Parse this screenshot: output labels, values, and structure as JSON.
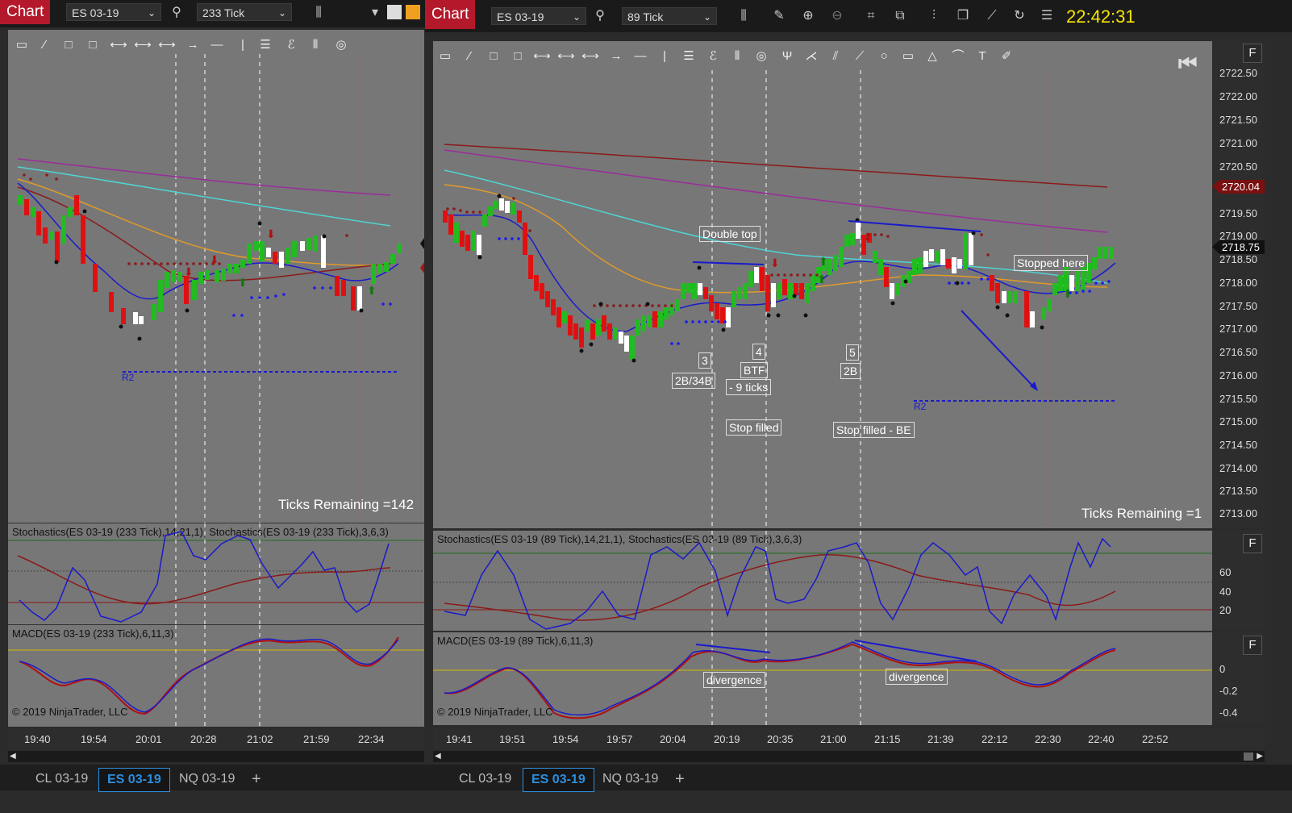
{
  "left": {
    "toolbar": {
      "chart_label": "Chart",
      "instrument": "ES 03-19",
      "interval": "233 Tick"
    },
    "drawing_tools": [
      "ruler-icon",
      "risk-reward-icon",
      "rectangle-icon",
      "rectangle-icon",
      "line-icon",
      "line-icon",
      "line-icon",
      "arrow-line-icon",
      "horizontal-line-icon",
      "vertical-line-icon",
      "lines-icon",
      "fib-icon",
      "time-cycles-icon",
      "circle-target-icon"
    ],
    "ticks_remaining": "Ticks Remaining =142",
    "r2_label": "R2",
    "stoch_title": "Stochastics(ES 03-19 (233 Tick),14,21,1), Stochastics(ES 03-19 (233 Tick),3,6,3)",
    "macd_title": "MACD(ES 03-19 (233 Tick),6,11,3)",
    "copyright": "© 2019 NinjaTrader, LLC",
    "time_ticks": [
      "19:40",
      "19:54",
      "20:01",
      "20:28",
      "21:02",
      "21:59",
      "22:34"
    ],
    "tabs": [
      "CL 03-19",
      "ES 03-19",
      "NQ 03-19"
    ],
    "add_tab": "+",
    "active_tab": "ES 03-19"
  },
  "right": {
    "toolbar": {
      "chart_label": "Chart",
      "instrument": "ES 03-19",
      "interval": "89 Tick",
      "clock": "22:42:31"
    },
    "drawing_tools": [
      "ruler-icon",
      "risk-reward-icon",
      "rectangle-icon",
      "rectangle-icon",
      "line-icon",
      "line-icon",
      "line-icon",
      "arrow-line-icon",
      "horizontal-line-icon",
      "vertical-line-icon",
      "lines-icon",
      "fib-icon",
      "time-cycles-icon",
      "circle-target-icon",
      "pitchfork-icon",
      "gann-fan-icon",
      "regression-icon",
      "ray-icon",
      "ellipse-icon",
      "rectangle-icon",
      "triangle-icon",
      "arc-icon",
      "text-icon",
      "marker-icon"
    ],
    "price_ticks": [
      "2722.50",
      "2722.00",
      "2721.50",
      "2721.00",
      "2720.50",
      "2720.00",
      "2719.50",
      "2719.00",
      "2718.50",
      "2718.00",
      "2717.50",
      "2717.00",
      "2716.50",
      "2716.00",
      "2715.50",
      "2715.00",
      "2714.50",
      "2714.00",
      "2713.50",
      "2713.00"
    ],
    "price_flag_red": "2720.04",
    "price_flag_current": "2718.75",
    "annotations": {
      "double_top": "Double top",
      "n3": "3",
      "n3_label": "2B/34B",
      "n4": "4",
      "n4_label": "BTF",
      "n4_ticks": "- 9 ticks",
      "stop_filled": "Stop filled",
      "n5": "5",
      "n5_label": "2B",
      "stop_filled_be": "Stop filled - BE",
      "stopped_here": "Stopped here",
      "divergence1": "divergence",
      "divergence2": "divergence"
    },
    "r2_label": "R2",
    "ticks_remaining": "Ticks Remaining =1",
    "stoch_title": "Stochastics(ES 03-19 (89 Tick),14,21,1), Stochastics(ES 03-19 (89 Tick),3,6,3)",
    "stoch_axis": [
      "60",
      "40",
      "20"
    ],
    "macd_title": "MACD(ES 03-19 (89 Tick),6,11,3)",
    "macd_axis": [
      "0",
      "-0.2",
      "-0.4"
    ],
    "copyright": "© 2019 NinjaTrader, LLC",
    "time_ticks": [
      "19:41",
      "19:51",
      "19:54",
      "19:57",
      "20:04",
      "20:19",
      "20:35",
      "21:00",
      "21:15",
      "21:39",
      "22:12",
      "22:30",
      "22:40",
      "22:52"
    ],
    "f_button": "F",
    "tabs": [
      "CL 03-19",
      "ES 03-19",
      "NQ 03-19"
    ],
    "add_tab": "+",
    "active_tab": "ES 03-19"
  }
}
